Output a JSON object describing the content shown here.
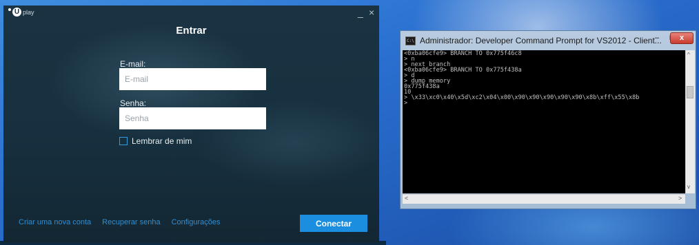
{
  "uplay": {
    "logo_text": "play",
    "logo_letter": "U",
    "minimize_glyph": "_",
    "close_glyph": "×",
    "title": "Entrar",
    "email_label": "E-mail:",
    "email_placeholder": "E-mail",
    "email_value": "",
    "password_label": "Senha:",
    "password_placeholder": "Senha",
    "password_value": "",
    "remember_label": "Lembrar de mim",
    "remember_checked": false,
    "create_account_link": "Criar uma nova conta",
    "recover_password_link": "Recuperar senha",
    "settings_link": "Configurações",
    "connect_button": "Conectar",
    "accent_color": "#1b8ee0"
  },
  "cmd": {
    "icon_text": "C:\\",
    "title": "Administrador: Developer Command Prompt for VS2012 - Client...",
    "minimize_glyph": "–",
    "maximize_glyph": "□",
    "close_glyph": "x",
    "console_text": "<0xba06cfe9> BRANCH TO 0x775f46c8\n> n\n> next branch\n<0xba06cfe9> BRANCH TO 0x775f438a\n> d\n> dump memory\n0x775f438a\n10\n> \\x33\\xc0\\x40\\x5d\\xc2\\x04\\x00\\x90\\x90\\x90\\x90\\x90\\x8b\\xff\\x55\\x8b\n>",
    "scroll_up_glyph": "^",
    "scroll_down_glyph": "v",
    "scroll_left_glyph": "<",
    "scroll_right_glyph": ">",
    "close_color": "#c83c2e"
  }
}
